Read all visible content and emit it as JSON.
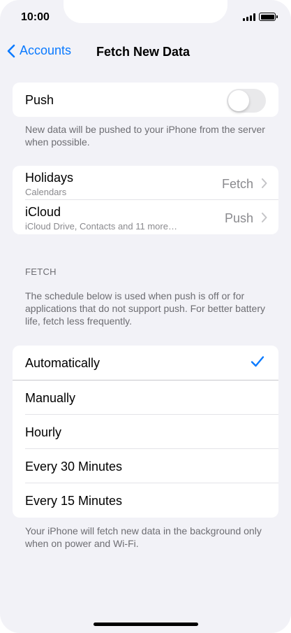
{
  "status_bar": {
    "time": "10:00"
  },
  "nav": {
    "back_label": "Accounts",
    "title": "Fetch New Data"
  },
  "push": {
    "label": "Push",
    "enabled": false,
    "footnote": "New data will be pushed to your iPhone from the server when possible."
  },
  "accounts": [
    {
      "name": "Holidays",
      "subtitle": "Calendars",
      "value": "Fetch"
    },
    {
      "name": "iCloud",
      "subtitle": "iCloud Drive, Contacts and 11 more…",
      "value": "Push"
    }
  ],
  "fetch": {
    "header": "FETCH",
    "description": "The schedule below is used when push is off or for applications that do not support push. For better battery life, fetch less frequently.",
    "options": [
      "Automatically",
      "Manually",
      "Hourly",
      "Every 30 Minutes",
      "Every 15 Minutes"
    ],
    "selected": "Automatically",
    "footnote": "Your iPhone will fetch new data in the background only when on power and Wi-Fi."
  },
  "colors": {
    "accent": "#0a7aff",
    "background": "#f2f2f7",
    "secondary_text": "#8a8a8e"
  }
}
